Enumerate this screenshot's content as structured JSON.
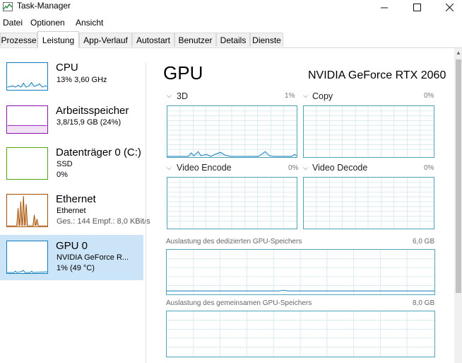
{
  "window": {
    "title": "Task-Manager",
    "minimize_icon": "minimize-icon",
    "maximize_icon": "maximize-icon",
    "close_icon": "close-icon"
  },
  "menu": [
    "Datei",
    "Optionen",
    "Ansicht"
  ],
  "tabs": [
    "Prozesse",
    "Leistung",
    "App-Verlauf",
    "Autostart",
    "Benutzer",
    "Details",
    "Dienste"
  ],
  "active_tab": "Leistung",
  "sidebar": {
    "items": [
      {
        "title": "CPU",
        "line1": "13% 3,60 GHz",
        "line2": "",
        "line3": "",
        "color": "#117dbb"
      },
      {
        "title": "Arbeitsspeicher",
        "line1": "3,8/15,9 GB (24%)",
        "line2": "",
        "line3": "",
        "color": "#8b12ae"
      },
      {
        "title": "Datenträger 0 (C:)",
        "line1": "SSD",
        "line2": "0%",
        "line3": "",
        "color": "#4da60c"
      },
      {
        "title": "Ethernet",
        "line1": "Ethernet",
        "line2": "Ges.: 144  Empf.: 8,0 KBit/s",
        "line3": "",
        "color": "#a74f01"
      },
      {
        "title": "GPU 0",
        "line1": "NVIDIA GeForce R...",
        "line2": "1%  (49 °C)",
        "line3": "",
        "color": "#117dbb"
      }
    ],
    "selected_index": 4
  },
  "main": {
    "heading": "GPU",
    "model": "NVIDIA GeForce RTX 2060",
    "engines": [
      {
        "label": "3D",
        "percent": "1%"
      },
      {
        "label": "Copy",
        "percent": "0%"
      },
      {
        "label": "Video Encode",
        "percent": "0%"
      },
      {
        "label": "Video Decode",
        "percent": "0%"
      }
    ],
    "dedicated_memory": {
      "label": "Auslastung des dedizierten GPU-Speichers",
      "value": "6,0 GB"
    },
    "shared_memory": {
      "label": "Auslastung des gemeinsamen GPU-Speichers",
      "value": "8,0 GB"
    }
  },
  "colors": {
    "accent_gpu": "#117dbb",
    "graph_border": "#4fa3b8",
    "selection": "#cce4f7"
  }
}
